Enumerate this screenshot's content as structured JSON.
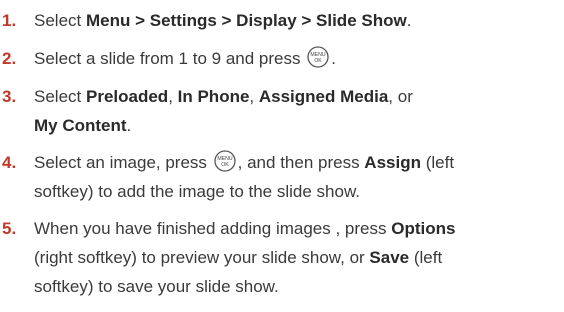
{
  "colors": {
    "number": "#c0392b",
    "text": "#3a3a3a"
  },
  "icons": {
    "menu_ok_key": "menu-ok-key-icon"
  },
  "menu_key_label_top": "MENU",
  "menu_key_label_bottom": "OK",
  "steps": [
    {
      "number": "1.",
      "parts": {
        "a": "Select ",
        "b": "Menu > Settings > Display > Slide Show",
        "c": "."
      }
    },
    {
      "number": "2.",
      "parts": {
        "a": "Select a slide from 1 to 9 and press ",
        "c": "."
      }
    },
    {
      "number": "3.",
      "parts": {
        "a": "Select ",
        "b1": "Preloaded",
        "c1": ", ",
        "b2": "In Phone",
        "c2": ", ",
        "b3": "Assigned Media",
        "c3": ", or",
        "b4": "My Content",
        "c4": "."
      }
    },
    {
      "number": "4.",
      "parts": {
        "a": "Select an image, press ",
        "c": ", and then press ",
        "b": "Assign",
        "d": " (left",
        "e": "softkey) to add the image to the slide show."
      }
    },
    {
      "number": "5.",
      "parts": {
        "a": "When you have finished adding images , press ",
        "b1": "Options",
        "c1": "(right softkey) to preview your slide show, or ",
        "b2": "Save",
        "c2": " (left",
        "d": "softkey) to save your slide show."
      }
    }
  ]
}
